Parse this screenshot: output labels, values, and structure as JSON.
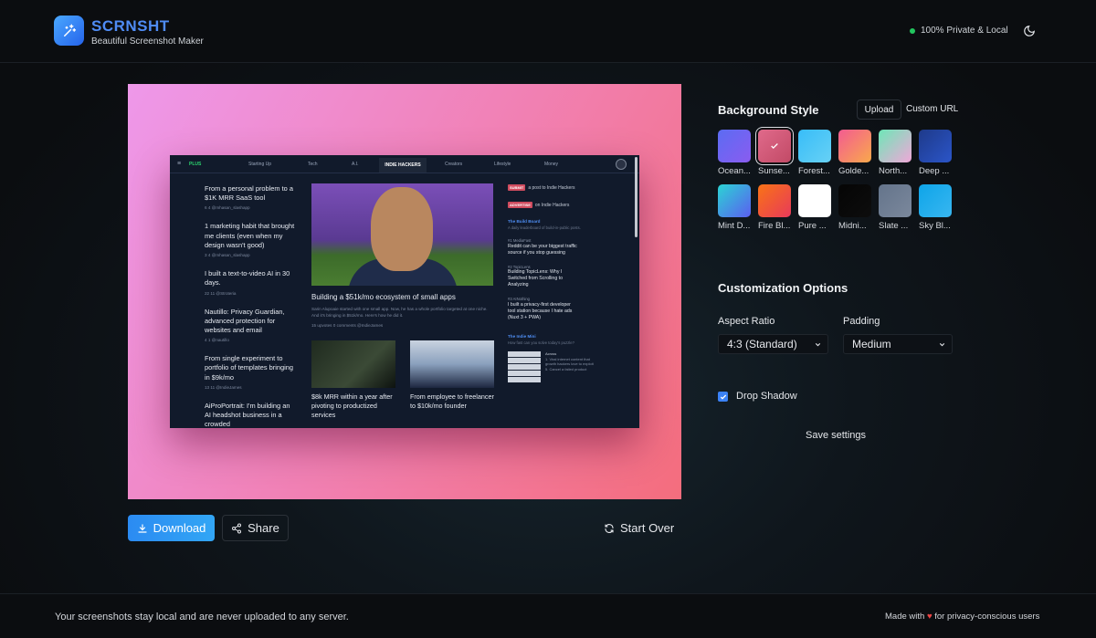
{
  "header": {
    "brand": "SCRNSHT",
    "tagline": "Beautiful Screenshot Maker",
    "privacy_status": "100% Private & Local"
  },
  "preview": {
    "nav": {
      "logo": "PLUS",
      "items": [
        "Starting Up",
        "Tech",
        "A.I.",
        "INDIE HACKERS",
        "Creators",
        "Lifestyle",
        "Money"
      ]
    },
    "left_posts": [
      {
        "title": "From a personal problem to a $1K MRR SaaS tool",
        "meta": "6   4   @mhasan_slashapp"
      },
      {
        "title": "1 marketing habit that brought me clients (even when my design wasn't good)",
        "meta": "3   4   @mhasan_slashapp"
      },
      {
        "title": "I built a text-to-video AI in 30 days.",
        "meta": "22   11   @Stroteria"
      },
      {
        "title": "Nautillo: Privacy Guardian, advanced protection for websites and email",
        "meta": "4   1   @nautillo"
      },
      {
        "title": "From single experiment to portfolio of templates bringing in $9k/mo",
        "meta": "13   11   @IndieJames"
      },
      {
        "title": "AiProPortrait: I'm building an AI headshot business in a crowded",
        "meta": ""
      }
    ],
    "feature": {
      "title": "Building a $51k/mo ecosystem of small apps",
      "description": "Sarin Alupoaie started with one small app. Now, he has a whole portfolio targeted at one niche. And it's bringing in $51k/mo. Here's how he did it.",
      "meta": "15 upvotes   0 comments   @IndieJames"
    },
    "thumb_posts": [
      {
        "title": "$8k MRR within a year after pivoting to productized services"
      },
      {
        "title": "From employee to freelancer to $10k/mo founder"
      }
    ],
    "sidebar": {
      "submit_tag": "SUBMIT",
      "submit_text": "a post to Indie Hackers",
      "advertise_tag": "ADVERTISE",
      "advertise_text": "on Indie Hackers",
      "board_title": "The Build Board",
      "board_sub": "A daily leaderboard of build-in-public posts.",
      "items": [
        {
          "rank": "#1",
          "source": "MediaFast",
          "title": "Reddit can be your biggest traffic source if you stop guessing"
        },
        {
          "rank": "#2",
          "source": "TopicLens",
          "title": "Building TopicLens: Why I Switched from Scrolling to Analyzing"
        },
        {
          "rank": "#3",
          "source": "AINothing",
          "title": "I built a privacy-first developer tool station because I hate ads (Nuxt 3 + PWA)"
        }
      ],
      "mini_title": "The Indie Mini",
      "mini_sub": "How fast can you solve today's puzzle?",
      "mini_across": "Across",
      "mini_clues": "1. Viral internet content that growth hackers love to exploit  5. Cancel a failed product"
    }
  },
  "actions": {
    "download": "Download",
    "share": "Share",
    "start_over": "Start Over"
  },
  "background": {
    "title": "Background Style",
    "upload": "Upload",
    "custom_url": "Custom URL",
    "swatches": [
      {
        "label": "Ocean...",
        "from": "#5b6cf3",
        "to": "#8a5cf0"
      },
      {
        "label": "Sunse...",
        "from": "#e06a8b",
        "to": "#c24a66",
        "selected": true
      },
      {
        "label": "Forest...",
        "from": "#38bdf8",
        "to": "#67d1f5"
      },
      {
        "label": "Golde...",
        "from": "#f35b92",
        "to": "#f9a94b"
      },
      {
        "label": "North...",
        "from": "#6ee7b7",
        "to": "#f0a7d8"
      },
      {
        "label": "Deep ...",
        "from": "#1e3a8a",
        "to": "#2b55c8"
      },
      {
        "label": "Mint D...",
        "from": "#2bd4d4",
        "to": "#5b5ef0"
      },
      {
        "label": "Fire Bl...",
        "from": "#f97316",
        "to": "#e83a5a"
      },
      {
        "label": "Pure ...",
        "from": "#ffffff",
        "to": "#ffffff"
      },
      {
        "label": "Midni...",
        "from": "#050505",
        "to": "#0d0d0d"
      },
      {
        "label": "Slate ...",
        "from": "#64748b",
        "to": "#7b889c"
      },
      {
        "label": "Sky Bl...",
        "from": "#0ea5e9",
        "to": "#38b6f0"
      }
    ]
  },
  "customization": {
    "title": "Customization Options",
    "aspect_label": "Aspect Ratio",
    "aspect_value": "4:3 (Standard)",
    "padding_label": "Padding",
    "padding_value": "Medium",
    "shadow_label": "Drop Shadow",
    "shadow_checked": true,
    "save": "Save settings"
  },
  "footer": {
    "left": "Your screenshots stay local and are never uploaded to any server.",
    "right_prefix": "Made with",
    "right_suffix": "for privacy-conscious users"
  }
}
